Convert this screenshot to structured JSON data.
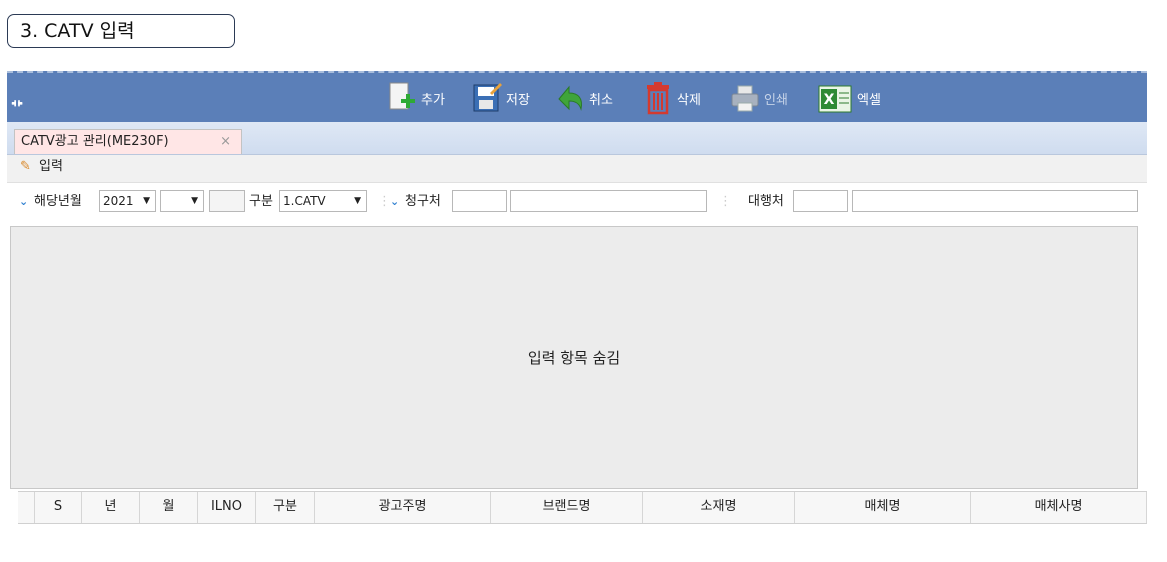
{
  "section_title": "3. CATV 입력",
  "toolbar": {
    "buttons": [
      {
        "label": "추가",
        "icon": "add-document-icon"
      },
      {
        "label": "저장",
        "icon": "save-icon"
      },
      {
        "label": "취소",
        "icon": "undo-arrow-icon"
      },
      {
        "label": "삭제",
        "icon": "trash-icon"
      },
      {
        "label": "인쇄",
        "icon": "printer-icon"
      },
      {
        "label": "엑셀",
        "icon": "excel-icon"
      }
    ],
    "collapse_icon": "collapse-icon"
  },
  "tabs": [
    {
      "label": "CATV광고 관리(ME230F)",
      "close": "×"
    }
  ],
  "subbar": {
    "label": "입력",
    "icon": "pencil-icon"
  },
  "filters": {
    "period_label": "해당년월",
    "year": "2021",
    "month": "",
    "blank": "",
    "type_label": "구분",
    "type_value": "1.CATV",
    "bill_to_label": "청구처",
    "bill_to_code": "",
    "bill_to_name": "",
    "agency_label": "대행처",
    "agency_code": "",
    "agency_name": ""
  },
  "hidden_panel_text": "입력 항목 숨김",
  "grid": {
    "columns": [
      "",
      "S",
      "년",
      "월",
      "ILNO",
      "구분",
      "광고주명",
      "브랜드명",
      "소재명",
      "매체명",
      "매체사명"
    ]
  },
  "colors": {
    "toolbar_bg": "#5b7fb8",
    "tab_bg": "#ffe6e6",
    "panel_bg": "#ececec"
  }
}
